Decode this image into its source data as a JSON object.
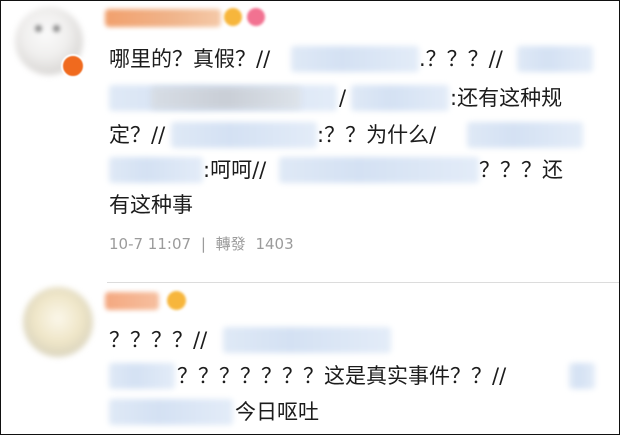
{
  "comments": [
    {
      "username": "",
      "lines": {
        "l1_a": "哪里的？真假？//",
        "l1_b": ".？？？//",
        "l2_a": "/",
        "l2_b": ":还有这种规",
        "l3_a": "定？//",
        "l3_b": ":？？为什么/",
        "l4_a": ":呵呵//",
        "l4_b": "？？？还",
        "l5": "有这种事"
      },
      "meta": {
        "date": "10-7 11:07",
        "separator": "|",
        "repost_label": "轉發",
        "repost_count": "1403"
      }
    },
    {
      "username": "",
      "lines": {
        "l1_a": "？？？？//",
        "l2_a": "？？？？？？？这是真实事件？？//",
        "l3_a": "今日呕吐"
      }
    }
  ]
}
